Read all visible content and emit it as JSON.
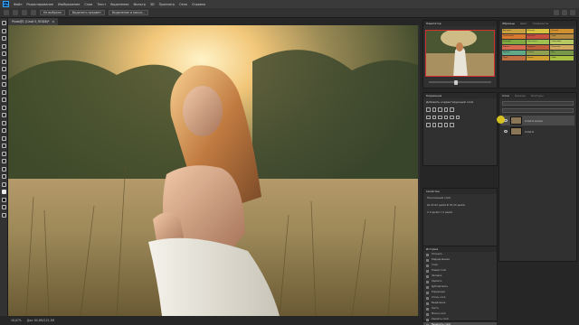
{
  "app": {
    "logo": "Ps"
  },
  "menu": [
    "Файл",
    "Редактирование",
    "Изображение",
    "Слои",
    "Текст",
    "Выделение",
    "Фильтр",
    "3D",
    "Просмотр",
    "Окно",
    "Справка"
  ],
  "options": {
    "buttons": [
      "Не выбрано",
      "Выделить предмет",
      "Выделение и маска..."
    ],
    "icons": [
      "marquee-icon",
      "add-selection-icon",
      "subtract-selection-icon",
      "intersect-selection-icon"
    ]
  },
  "document": {
    "tab_title": "Photo@1 (Слой 0, RGB/8)*",
    "tab_close": "×"
  },
  "status": {
    "zoom": "16,67%",
    "doc_size": "Док: 60,8M/122,3M"
  },
  "panels": {
    "navigator": {
      "title": "Навигатор"
    },
    "swatches": {
      "tabs": [
        "Образцы",
        "Цвет",
        "Градиенты"
      ],
      "items": [
        {
          "label": "Автоцвет",
          "color": "#c8a040"
        },
        {
          "label": "Желтый",
          "color": "#d8c040"
        },
        {
          "label": "Теплый",
          "color": "#d09030"
        },
        {
          "label": "Оранжевый",
          "color": "#d87a30"
        },
        {
          "label": "Красный",
          "color": "#c85040"
        },
        {
          "label": "Охра",
          "color": "#b88a40"
        },
        {
          "label": "Зеленый",
          "color": "#80a840"
        },
        {
          "label": "Светло-зел.",
          "color": "#a0c050"
        },
        {
          "label": "Салатовый",
          "color": "#b8c860"
        },
        {
          "label": "Коралл",
          "color": "#d86a50"
        },
        {
          "label": "Терракот",
          "color": "#c0603a"
        },
        {
          "label": "Песочный",
          "color": "#d0a860"
        },
        {
          "label": "Бирюза",
          "color": "#60a888"
        },
        {
          "label": "Оливка",
          "color": "#90a050"
        },
        {
          "label": "Мох",
          "color": "#789848"
        },
        {
          "label": "Медь",
          "color": "#c07040"
        },
        {
          "label": "Золото",
          "color": "#d0a030"
        },
        {
          "label": "Лайм",
          "color": "#a8c040"
        }
      ]
    },
    "adjustments": {
      "title": "Коррекция",
      "subtitle": "Добавить корректирующий слой"
    },
    "properties": {
      "title": "Свойства",
      "lines": [
        "Пиксельный слой",
        "Ш 23,62 дюйм  В 35,43 дюйм",
        "X 0 дюйм   Y 0 дюйм"
      ]
    },
    "layers": {
      "title": "Слои",
      "tabs": [
        "Слои",
        "Каналы",
        "Контуры"
      ],
      "items": [
        {
          "name": "Слой 0 копия",
          "selected": true
        },
        {
          "name": "Слой 0",
          "selected": false
        }
      ]
    },
    "history": {
      "title": "История",
      "items": [
        "Открыть",
        "Кадрирование",
        "Слой",
        "Новый слой",
        "Заливка",
        "Удалить",
        "Дублировать",
        "Коррекция",
        "Стиль слоя",
        "Выделение",
        "Кисть",
        "Маска слоя",
        "Удалить слой",
        "Выделить слой"
      ],
      "selected_index": 13
    }
  },
  "colors": {
    "accent": "#31a8ff",
    "menubar": "#3a3a3a",
    "panel": "#303030",
    "selection": "#4a4a4a"
  }
}
